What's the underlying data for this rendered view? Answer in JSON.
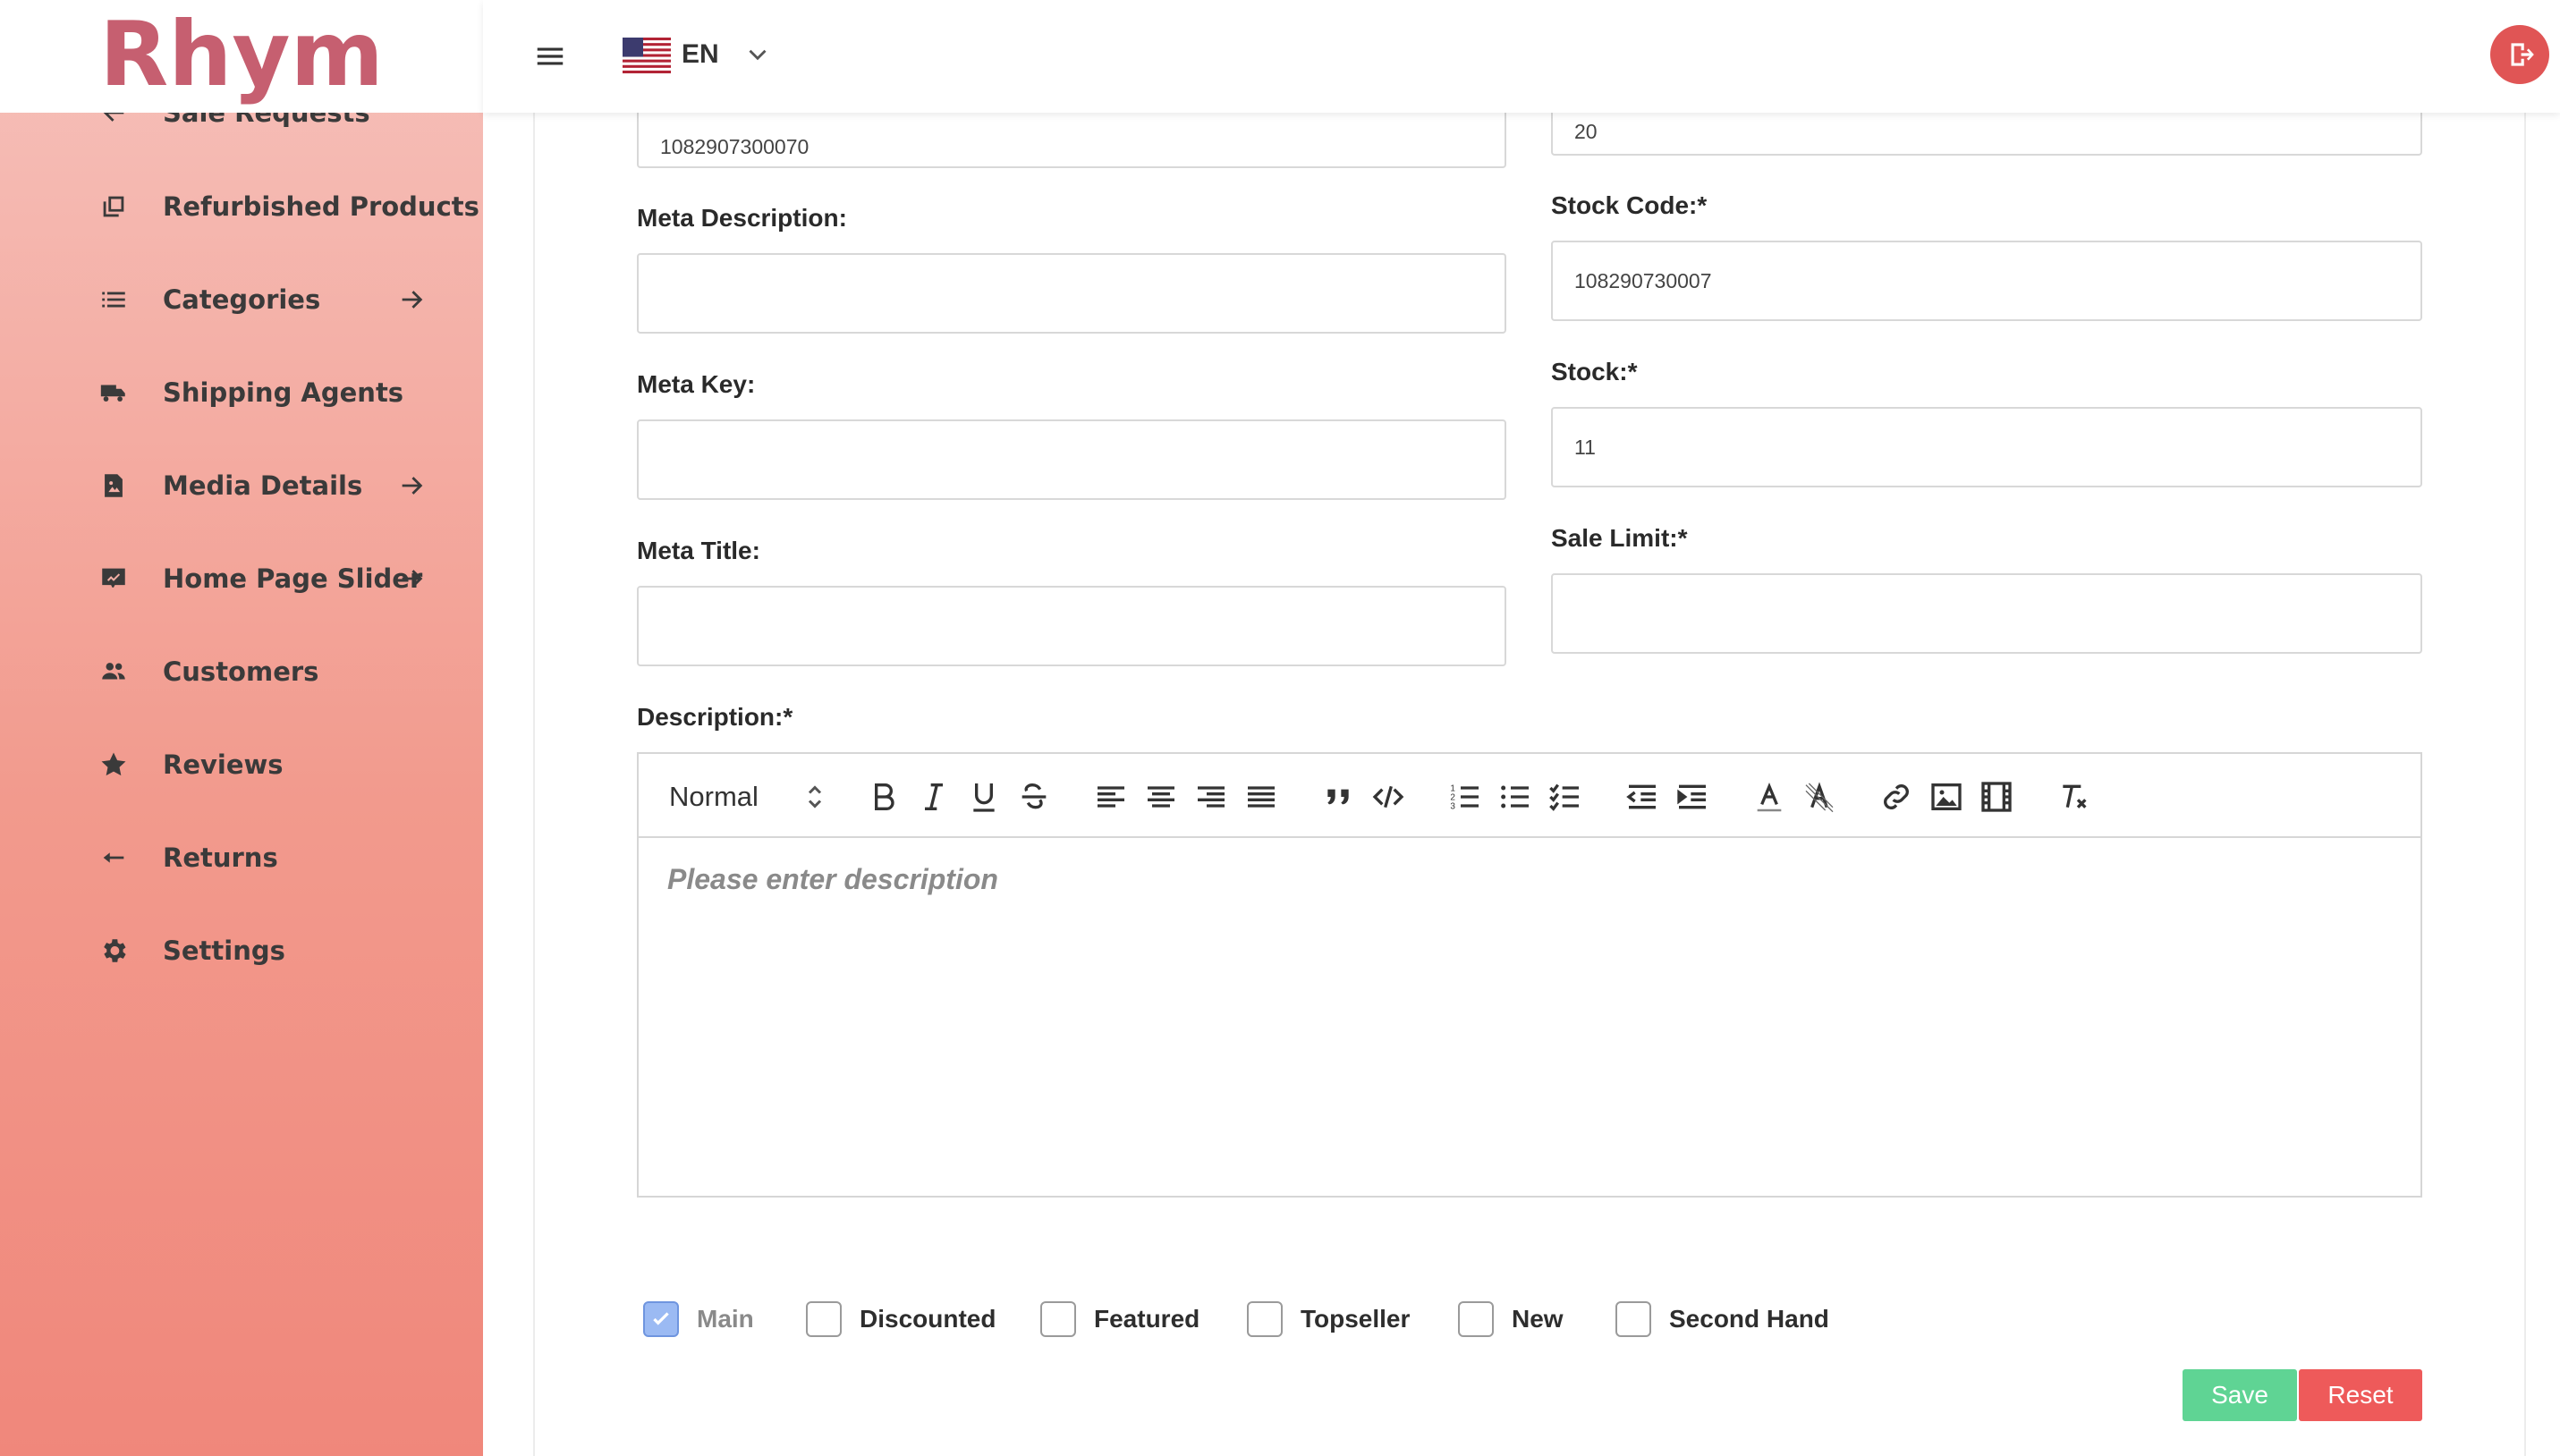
{
  "app": {
    "logo_text": "Rhym"
  },
  "topbar": {
    "language": "EN"
  },
  "sidebar": {
    "items": [
      {
        "label": "Sale Requests",
        "icon": "arrow-left-icon",
        "has_arrow": false
      },
      {
        "label": "Refurbished Products",
        "icon": "copy-icon",
        "has_arrow": false
      },
      {
        "label": "Categories",
        "icon": "list-icon",
        "has_arrow": true
      },
      {
        "label": "Shipping Agents",
        "icon": "truck-icon",
        "has_arrow": false
      },
      {
        "label": "Media Details",
        "icon": "image-file-icon",
        "has_arrow": true
      },
      {
        "label": "Home Page Slider",
        "icon": "slideshow-icon",
        "has_arrow": true
      },
      {
        "label": "Customers",
        "icon": "people-icon",
        "has_arrow": false
      },
      {
        "label": "Reviews",
        "icon": "star-icon",
        "has_arrow": false
      },
      {
        "label": "Returns",
        "icon": "return-icon",
        "has_arrow": false
      },
      {
        "label": "Settings",
        "icon": "gear-icon",
        "has_arrow": false
      }
    ]
  },
  "form": {
    "left": {
      "top_value": "1082907300070",
      "meta_description": {
        "label": "Meta Description:",
        "value": ""
      },
      "meta_key": {
        "label": "Meta Key:",
        "value": ""
      },
      "meta_title": {
        "label": "Meta Title:",
        "value": ""
      }
    },
    "right": {
      "top_value": "20",
      "stock_code": {
        "label": "Stock Code:*",
        "value": "108290730007"
      },
      "stock": {
        "label": "Stock:*",
        "value": "11"
      },
      "sale_limit": {
        "label": "Sale Limit:*",
        "value": ""
      }
    },
    "description": {
      "label": "Description:*",
      "header_select": "Normal",
      "placeholder": "Please enter description"
    },
    "checkboxes": [
      {
        "label": "Main",
        "checked": true
      },
      {
        "label": "Discounted",
        "checked": false
      },
      {
        "label": "Featured",
        "checked": false
      },
      {
        "label": "Topseller",
        "checked": false
      },
      {
        "label": "New",
        "checked": false
      },
      {
        "label": "Second Hand",
        "checked": false
      }
    ],
    "save_label": "Save",
    "reset_label": "Reset"
  },
  "colors": {
    "logo": "#c65f70",
    "sidebar_top": "#f6c1bb",
    "sidebar_bottom": "#f0877b",
    "save": "#5fd494",
    "reset": "#ee5a5a",
    "logout": "#e05555"
  }
}
